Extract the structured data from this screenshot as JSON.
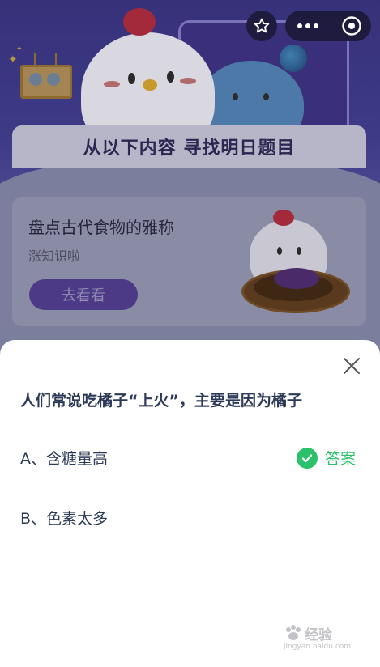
{
  "header": {
    "favorite_icon": "star-outline-icon",
    "more_icon": "ellipsis-icon",
    "close_icon": "circle-close-icon"
  },
  "banner": {
    "title": "从以下内容 寻找明日题目"
  },
  "card": {
    "title": "盘点古代食物的雅称",
    "subtitle": "涨知识啦",
    "button_label": "去看看"
  },
  "quiz": {
    "close_icon": "close-x-icon",
    "question": "人们常说吃橘子“上火”，主要是因为橘子",
    "options": [
      {
        "label": "A、含糖量高"
      },
      {
        "label": "B、色素太多"
      }
    ],
    "answer_label": "答案",
    "answer_color": "#2bc16b"
  },
  "watermark": {
    "text": "经验",
    "url": "jingyan.baidu.com"
  }
}
